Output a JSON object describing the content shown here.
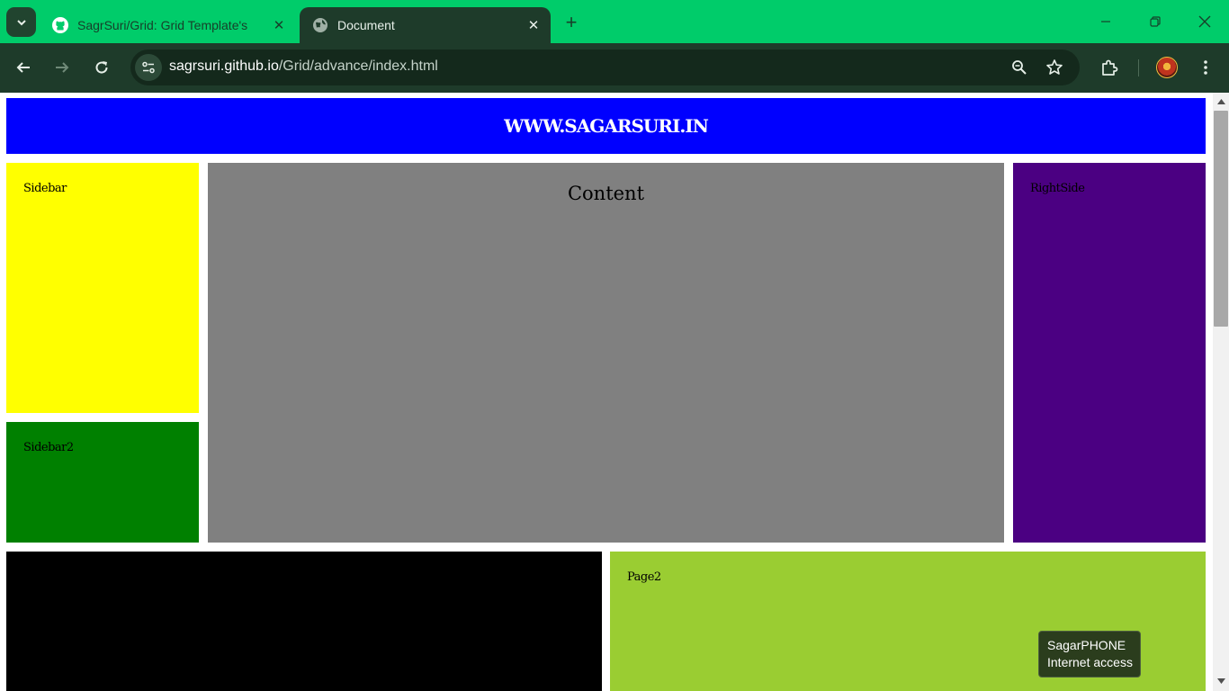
{
  "browser": {
    "tabs": [
      {
        "title": "SagrSuri/Grid: Grid Template's",
        "favicon": "github-icon",
        "active": false
      },
      {
        "title": "Document",
        "favicon": "globe-icon",
        "active": true
      }
    ],
    "url_host": "sagrsuri.github.io",
    "url_path": "/Grid/advance/index.html",
    "theme_color": "#00cc6a",
    "toolbar_color": "#1e3b2a"
  },
  "page": {
    "header_text": "WWW.SAGARSURI.IN",
    "sidebar_label": "Sidebar",
    "sidebar2_label": "Sidebar2",
    "content_label": "Content",
    "rightside_label": "RightSide",
    "page2_label": "Page2",
    "colors": {
      "header": "#0000ff",
      "sidebar": "#ffff00",
      "sidebar2": "#008000",
      "content": "#808080",
      "rightside": "#4b0082",
      "page1": "#000000",
      "page2": "#9acd32"
    }
  },
  "notification": {
    "line1": "SagarPHONE",
    "line2": "Internet access"
  }
}
